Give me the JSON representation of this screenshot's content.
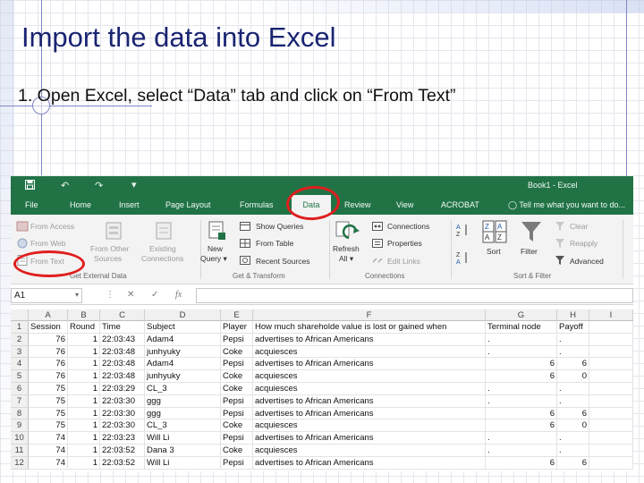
{
  "slide": {
    "title": "Import the data into Excel",
    "step": "1. Open Excel, select “Data” tab and click on “From Text”"
  },
  "excel": {
    "window_title": "Book1 - Excel",
    "tabs": [
      "File",
      "Home",
      "Insert",
      "Page Layout",
      "Formulas",
      "Data",
      "Review",
      "View",
      "ACROBAT"
    ],
    "active_tab": "Data",
    "tell_me": "Tell me what you want to do...",
    "ribbon": {
      "get_external_data": {
        "label": "Get External Data",
        "from_access": "From Access",
        "from_web": "From Web",
        "from_text": "From Text",
        "from_other_sources_1": "From Other",
        "from_other_sources_2": "Sources",
        "existing_connections_1": "Existing",
        "existing_connections_2": "Connections"
      },
      "get_transform": {
        "label": "Get & Transform",
        "new_query_1": "New",
        "new_query_2": "Query",
        "show_queries": "Show Queries",
        "from_table": "From Table",
        "recent_sources": "Recent Sources"
      },
      "connections": {
        "label": "Connections",
        "refresh_all_1": "Refresh",
        "refresh_all_2": "All",
        "connections": "Connections",
        "properties": "Properties",
        "edit_links": "Edit Links"
      },
      "sort_filter": {
        "label": "Sort & Filter",
        "sort": "Sort",
        "filter": "Filter",
        "clear": "Clear",
        "reapply": "Reapply",
        "advanced": "Advanced"
      }
    },
    "name_box": "A1",
    "columns": [
      "A",
      "B",
      "C",
      "D",
      "E",
      "F",
      "G",
      "H",
      "I"
    ],
    "rows": [
      {
        "n": "1",
        "a": "Session",
        "b": "Round",
        "c": "Time",
        "d": "Subject",
        "e": "Player",
        "f": "How much shareholde value is lost or gained when",
        "g": "Terminal node",
        "h": "Payoff"
      },
      {
        "n": "2",
        "a": "76",
        "b": "1",
        "c": "22:03:43",
        "d": "Adam4",
        "e": "Pepsi",
        "f": "advertises to African Americans",
        "g": ".",
        "h": "."
      },
      {
        "n": "3",
        "a": "76",
        "b": "1",
        "c": "22:03:48",
        "d": "junhyuky",
        "e": "Coke",
        "f": "acquiesces",
        "g": ".",
        "h": "."
      },
      {
        "n": "4",
        "a": "76",
        "b": "1",
        "c": "22:03:48",
        "d": "Adam4",
        "e": "Pepsi",
        "f": "advertises to African Americans",
        "g": "6",
        "h": "6"
      },
      {
        "n": "5",
        "a": "76",
        "b": "1",
        "c": "22:03:48",
        "d": "junhyuky",
        "e": "Coke",
        "f": "acquiesces",
        "g": "6",
        "h": "0"
      },
      {
        "n": "6",
        "a": "75",
        "b": "1",
        "c": "22:03:29",
        "d": "CL_3",
        "e": "Coke",
        "f": "acquiesces",
        "g": ".",
        "h": "."
      },
      {
        "n": "7",
        "a": "75",
        "b": "1",
        "c": "22:03:30",
        "d": "ggg",
        "e": "Pepsi",
        "f": "advertises to African Americans",
        "g": ".",
        "h": "."
      },
      {
        "n": "8",
        "a": "75",
        "b": "1",
        "c": "22:03:30",
        "d": "ggg",
        "e": "Pepsi",
        "f": "advertises to African Americans",
        "g": "6",
        "h": "6"
      },
      {
        "n": "9",
        "a": "75",
        "b": "1",
        "c": "22:03:30",
        "d": "CL_3",
        "e": "Coke",
        "f": "acquiesces",
        "g": "6",
        "h": "0"
      },
      {
        "n": "10",
        "a": "74",
        "b": "1",
        "c": "22:03:23",
        "d": "Will Li",
        "e": "Pepsi",
        "f": "advertises to African Americans",
        "g": ".",
        "h": "."
      },
      {
        "n": "11",
        "a": "74",
        "b": "1",
        "c": "22:03:52",
        "d": "Dana 3",
        "e": "Coke",
        "f": "acquiesces",
        "g": ".",
        "h": "."
      },
      {
        "n": "12",
        "a": "74",
        "b": "1",
        "c": "22:03:52",
        "d": "Will Li",
        "e": "Pepsi",
        "f": "advertises to African Americans",
        "g": "6",
        "h": "6"
      }
    ]
  },
  "colors": {
    "excel_green": "#217346",
    "title_blue": "#1a2472",
    "highlight_red": "#e01e1e"
  }
}
